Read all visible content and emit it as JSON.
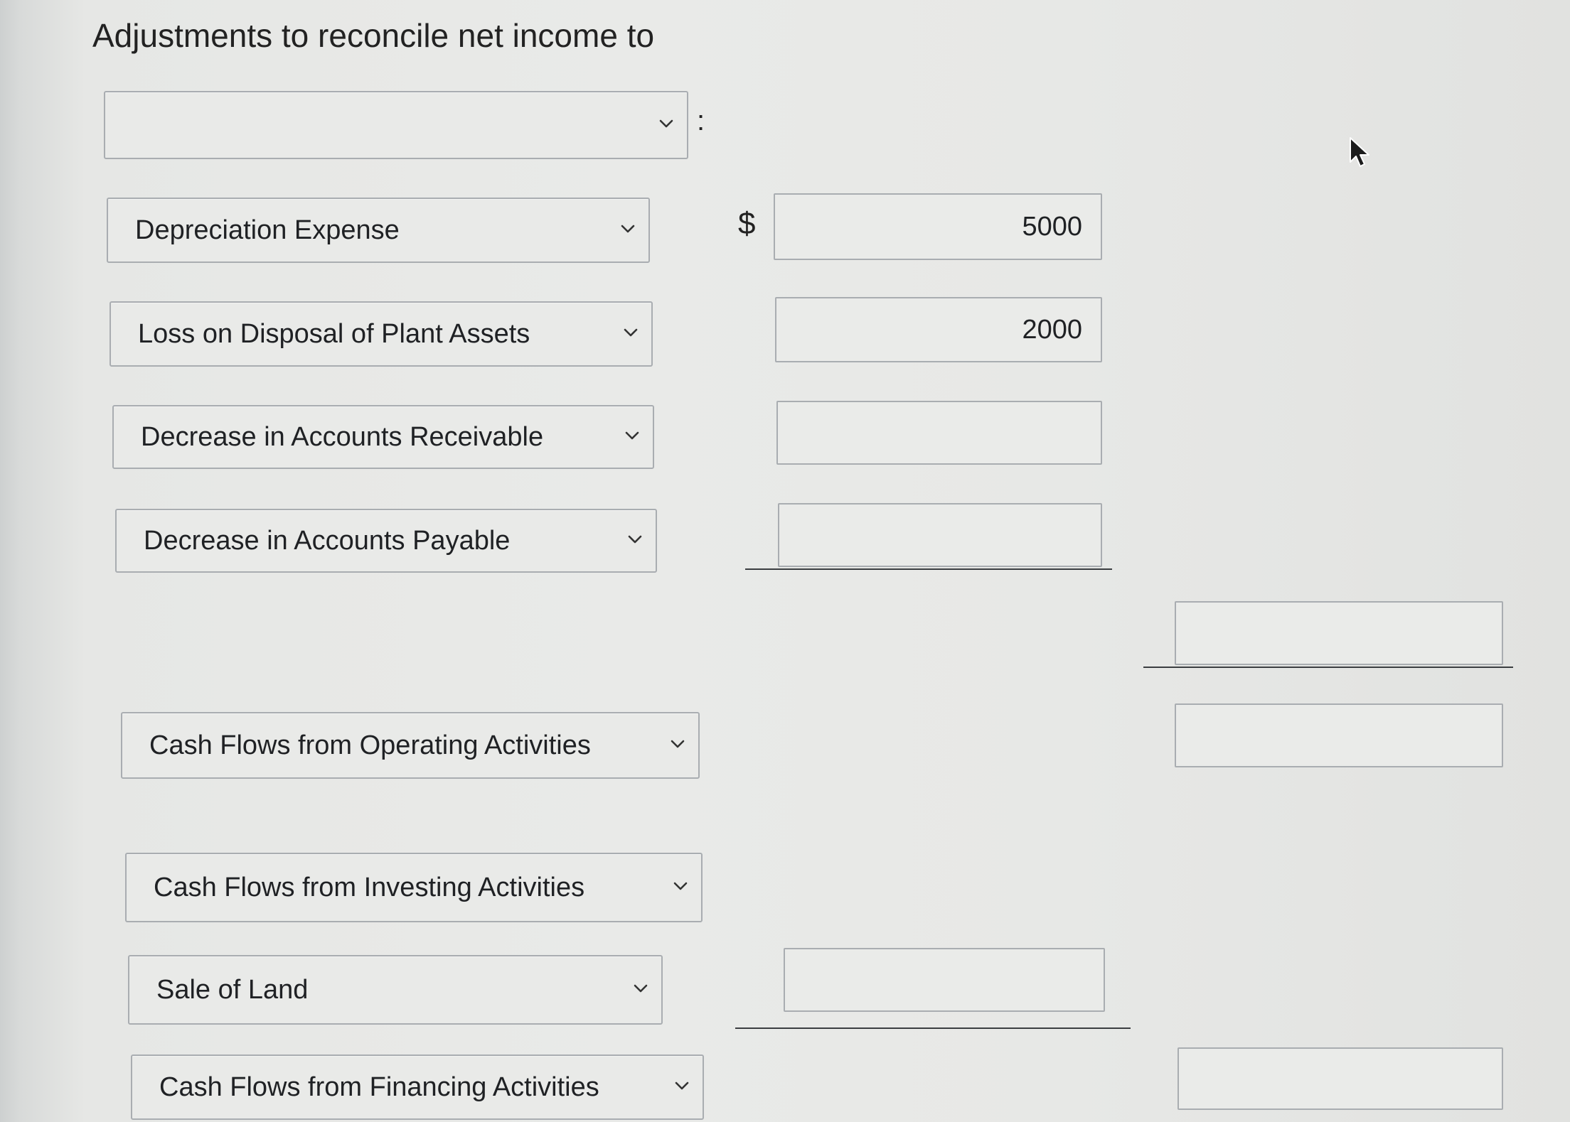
{
  "header": {
    "text": "Adjustments to reconcile net income to"
  },
  "symbols": {
    "colon": ":",
    "dollar": "$"
  },
  "rows": {
    "top_select": {
      "label": ""
    },
    "depreciation": {
      "label": "Depreciation Expense",
      "amount": "5000"
    },
    "loss_disposal": {
      "label": "Loss on Disposal of Plant Assets",
      "amount": "2000"
    },
    "decrease_ar": {
      "label": "Decrease in Accounts Receivable",
      "amount": ""
    },
    "decrease_ap": {
      "label": "Decrease in Accounts Payable",
      "amount": ""
    },
    "adjustments_total": {
      "amount": ""
    },
    "operating": {
      "label": "Cash Flows from Operating Activities",
      "amount": ""
    },
    "investing": {
      "label": "Cash Flows from Investing Activities"
    },
    "sale_land": {
      "label": "Sale of Land",
      "amount": ""
    },
    "financing": {
      "label": "Cash Flows from Financing Activities",
      "amount": ""
    }
  },
  "icons": {
    "dropdown": "chevron-down-icon",
    "pointer": "mouse-pointer-icon"
  }
}
